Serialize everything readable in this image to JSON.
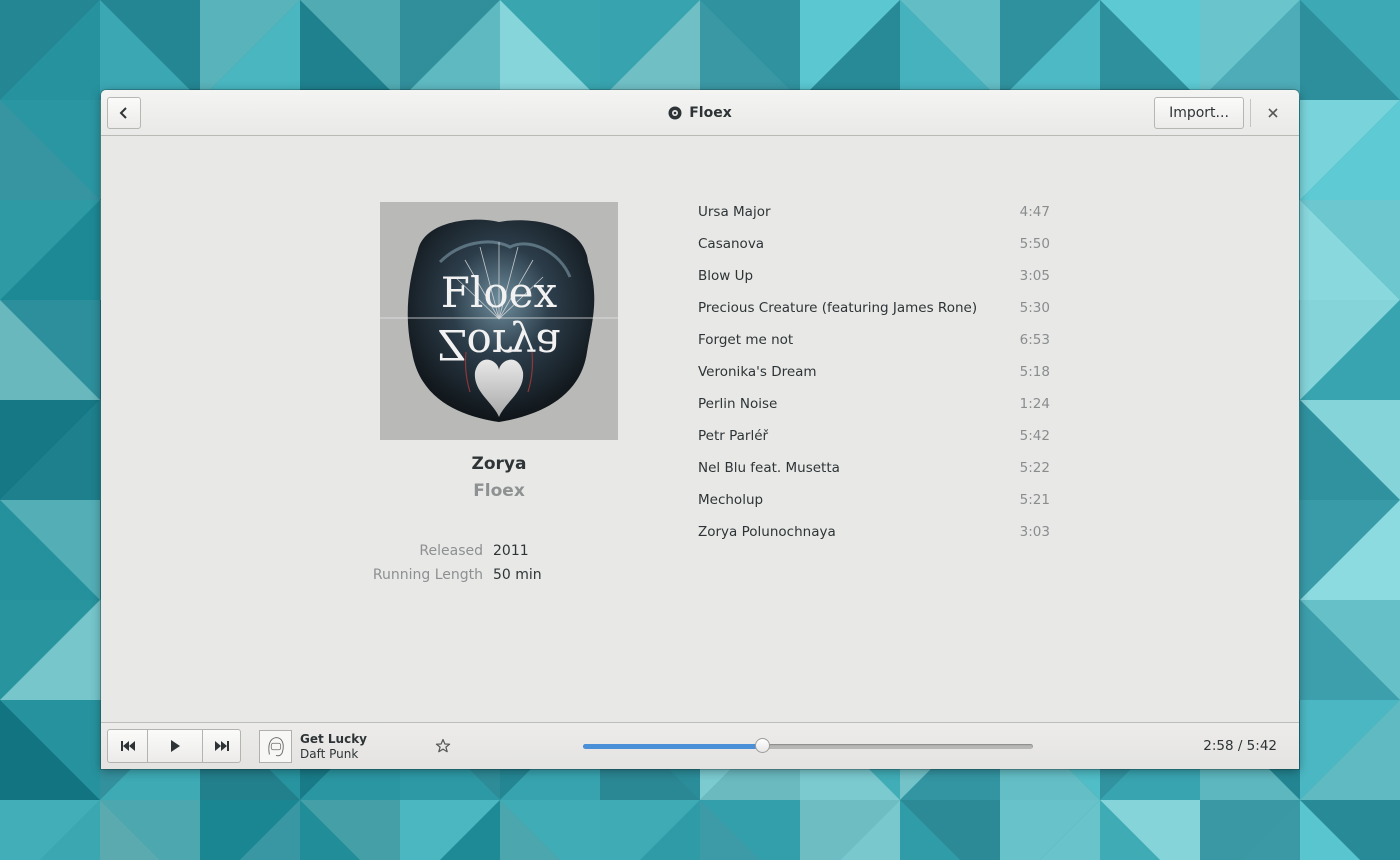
{
  "header": {
    "title": "Floex",
    "import_label": "Import...",
    "icons": {
      "back": "back-arrow-icon",
      "title": "disc-icon",
      "close": "close-icon"
    }
  },
  "album": {
    "cover_text_top": "Floex",
    "cover_text_bottom": "Zorya",
    "title": "Zorya",
    "artist": "Floex",
    "released_label": "Released",
    "released_value": "2011",
    "length_label": "Running Length",
    "length_value": "50 min"
  },
  "tracks": [
    {
      "title": "Ursa Major",
      "duration": "4:47"
    },
    {
      "title": "Casanova",
      "duration": "5:50"
    },
    {
      "title": "Blow Up",
      "duration": "3:05"
    },
    {
      "title": "Precious Creature (featuring James Rone)",
      "duration": "5:30"
    },
    {
      "title": "Forget me not",
      "duration": "6:53"
    },
    {
      "title": "Veronika's Dream",
      "duration": "5:18"
    },
    {
      "title": "Perlin Noise",
      "duration": "1:24"
    },
    {
      "title": "Petr Parléř",
      "duration": "5:42"
    },
    {
      "title": "Nel Blu feat. Musetta",
      "duration": "5:22"
    },
    {
      "title": "Mecholup",
      "duration": "5:21"
    },
    {
      "title": "Zorya Polunochnaya",
      "duration": "3:03"
    }
  ],
  "player": {
    "now_playing_title": "Get Lucky",
    "now_playing_artist": "Daft Punk",
    "time": "2:58 / 5:42",
    "progress_fraction": 0.4,
    "icons": {
      "prev": "skip-backward-icon",
      "play": "play-icon",
      "next": "skip-forward-icon",
      "star": "star-icon"
    }
  },
  "colors": {
    "accent": "#4a90d9",
    "window_bg": "#e8e8e7",
    "wallpaper": "#2e9aa6"
  }
}
